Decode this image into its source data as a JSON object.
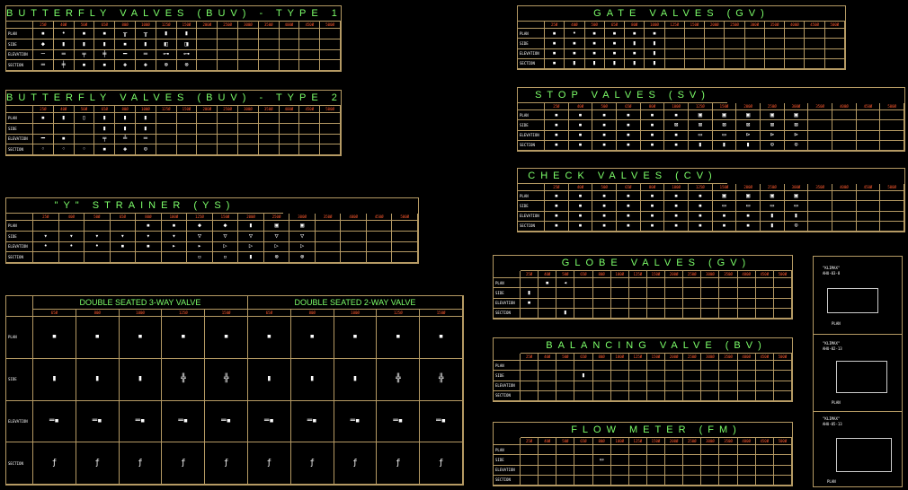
{
  "sizes_small": [
    "25Ø",
    "40Ø",
    "50Ø",
    "65Ø",
    "80Ø",
    "100Ø",
    "125Ø",
    "150Ø",
    "200Ø",
    "250Ø",
    "300Ø",
    "350Ø",
    "400Ø",
    "450Ø",
    "500Ø"
  ],
  "rows4": [
    "PLAN",
    "SIDE",
    "ELEVATION",
    "SECTION"
  ],
  "colors": {
    "frame": "#b59a64",
    "title": "#7dff6a",
    "size_header": "#ff5a2e",
    "symbol": "#ffffff",
    "background": "#000000"
  },
  "tables": [
    {
      "id": "bfv1",
      "title": "BUTTERFLY  VALVES  (BUV)  - TYPE 1",
      "filled": 8,
      "symbols": [
        [
          "▪",
          "•",
          "▪",
          "▪",
          "╥",
          "╥",
          "▮",
          "▮"
        ],
        [
          "◆",
          "▮",
          "▮",
          "▮",
          "▪",
          "▮",
          "◧",
          "◨"
        ],
        [
          "─",
          "═",
          "╤",
          "╪",
          "━",
          "═",
          "⊶",
          "⊶"
        ],
        [
          "═",
          "╪",
          "▪",
          "▪",
          "◈",
          "◈",
          "⊗",
          "⊗"
        ]
      ]
    },
    {
      "id": "bfv2",
      "title": "BUTTERFLY  VALVES  (BUV)  - TYPE 2",
      "filled": 6,
      "symbols": [
        [
          "▪",
          "▮",
          "▯",
          "▮",
          "▮",
          "▮"
        ],
        [
          "",
          "",
          "",
          "▮",
          "▮",
          "▮"
        ],
        [
          "━",
          "▪",
          "",
          "╤",
          "╧",
          "═"
        ],
        [
          "◦",
          "◦",
          "◦",
          "▪",
          "◈",
          "⊙"
        ]
      ]
    },
    {
      "id": "ys",
      "title": "\"Y\"  STRAINER  (YS)",
      "filled": 11,
      "symbols": [
        [
          "",
          "",
          "",
          "",
          "▪",
          "▪",
          "◆",
          "◆",
          "▮",
          "▣",
          "▣"
        ],
        [
          "▾",
          "▾",
          "▾",
          "▾",
          "▾",
          "▾",
          "▽",
          "▽",
          "▽",
          "▽",
          "▽"
        ],
        [
          "•",
          "•",
          "•",
          "▪",
          "▪",
          "▸",
          "▸",
          "▷",
          "▷",
          "▷",
          "▷"
        ],
        [
          "",
          "",
          "",
          "",
          "",
          "",
          "▫",
          "▫",
          "▮",
          "⊗",
          "⊗"
        ]
      ]
    },
    {
      "id": "gv",
      "title": "GATE  VALVES  (GV)",
      "filled": 6,
      "symbols": [
        [
          "▪",
          "•",
          "▪",
          "▪",
          "▪",
          "▪"
        ],
        [
          "▪",
          "▪",
          "▪",
          "▪",
          "▮",
          "▮"
        ],
        [
          "▪",
          "▪",
          "▪",
          "▪",
          "▪",
          "▮"
        ],
        [
          "▪",
          "▮",
          "▮",
          "▮",
          "▮",
          "▮"
        ]
      ]
    },
    {
      "id": "sv",
      "title": "STOP  VALVES  (SV)",
      "filled": 11,
      "symbols": [
        [
          "▪",
          "▪",
          "▪",
          "▪",
          "▪",
          "▪",
          "▣",
          "▣",
          "▣",
          "▣",
          "▣"
        ],
        [
          "▪",
          "▪",
          "▪",
          "▪",
          "▪",
          "⊠",
          "⊠",
          "⊠",
          "⊠",
          "⊠",
          "⊠"
        ],
        [
          "▪",
          "▪",
          "▪",
          "▪",
          "▪",
          "▪",
          "▭",
          "▭",
          "⊳",
          "⊳",
          "⊳"
        ],
        [
          "▪",
          "▪",
          "▪",
          "▪",
          "▪",
          "▪",
          "▮",
          "▮",
          "▮",
          "⊙",
          "⊙"
        ]
      ]
    },
    {
      "id": "cv",
      "title": "CHECK  VALVES  (CV)",
      "filled": 11,
      "symbols": [
        [
          "▪",
          "▪",
          "▪",
          "▪",
          "▪",
          "▪",
          "▪",
          "▣",
          "▣",
          "▣",
          "▣"
        ],
        [
          "▪",
          "▪",
          "▪",
          "▪",
          "▪",
          "▪",
          "▪",
          "▭",
          "▭",
          "▭",
          "▭"
        ],
        [
          "▪",
          "▪",
          "▪",
          "▪",
          "▪",
          "▪",
          "▪",
          "▪",
          "▪",
          "▮",
          "▮"
        ],
        [
          "▪",
          "▪",
          "▪",
          "▪",
          "▪",
          "▪",
          "▪",
          "▪",
          "▪",
          "▮",
          "⊙"
        ]
      ]
    },
    {
      "id": "glv",
      "title": "GLOBE  VALVES  (GV)",
      "filled": 3,
      "symbols": [
        [
          "",
          "▪",
          "◂"
        ],
        [
          "▮",
          "",
          ""
        ],
        [
          "▪",
          "",
          ""
        ],
        [
          "",
          "",
          "▮"
        ]
      ]
    },
    {
      "id": "bv",
      "title": "BALANCING  VALVE  (BV)",
      "filled": 4,
      "symbols": [
        [
          "",
          "",
          "",
          ""
        ],
        [
          "",
          "",
          "",
          "▮"
        ],
        [
          "",
          "",
          "",
          ""
        ],
        [
          "",
          "",
          "",
          ""
        ]
      ]
    },
    {
      "id": "fm",
      "title": "FLOW  METER  (FM)",
      "filled": 5,
      "symbols": [
        [
          "",
          "",
          "",
          "",
          ""
        ],
        [
          "",
          "",
          "",
          "",
          "▭"
        ],
        [
          "",
          "",
          "",
          "",
          ""
        ],
        [
          "",
          "",
          "",
          "",
          ""
        ]
      ]
    }
  ],
  "ds": {
    "title3": "DOUBLE SEATED 3-WAY VALVE",
    "title2": "DOUBLE SEATED 2-WAY VALVE",
    "sizes": [
      "65Ø",
      "80Ø",
      "100Ø",
      "125Ø",
      "150Ø",
      "65Ø",
      "80Ø",
      "100Ø",
      "125Ø",
      "150Ø"
    ],
    "rows": [
      "PLAN",
      "SIDE",
      "ELEVATION",
      "SECTION"
    ],
    "symbols": [
      [
        "▪",
        "▪",
        "▪",
        "▪",
        "▪",
        "▪",
        "▪",
        "▪",
        "▪",
        "▪"
      ],
      [
        "▮",
        "▮",
        "▮",
        "╬",
        "╬",
        "▮",
        "▮",
        "▮",
        "╬",
        "╬"
      ],
      [
        "═▪",
        "═▪",
        "═▪",
        "═▪",
        "═▪",
        "═▪",
        "═▪",
        "═▪",
        "═▪",
        "═▪"
      ],
      [
        "ƒ",
        "ƒ",
        "ƒ",
        "ƒ",
        "ƒ",
        "ƒ",
        "ƒ",
        "ƒ",
        "ƒ",
        "ƒ"
      ]
    ]
  },
  "details": [
    {
      "label": "\"KLIMAX\"",
      "unit": "AHU-03-8",
      "plan": "PLAN"
    },
    {
      "label": "\"KLIMAX\"",
      "unit": "AHU-02-13",
      "plan": "PLAN"
    },
    {
      "label": "\"KLIMAX\"",
      "unit": "AHU-05-13",
      "plan": "PLAN"
    }
  ]
}
